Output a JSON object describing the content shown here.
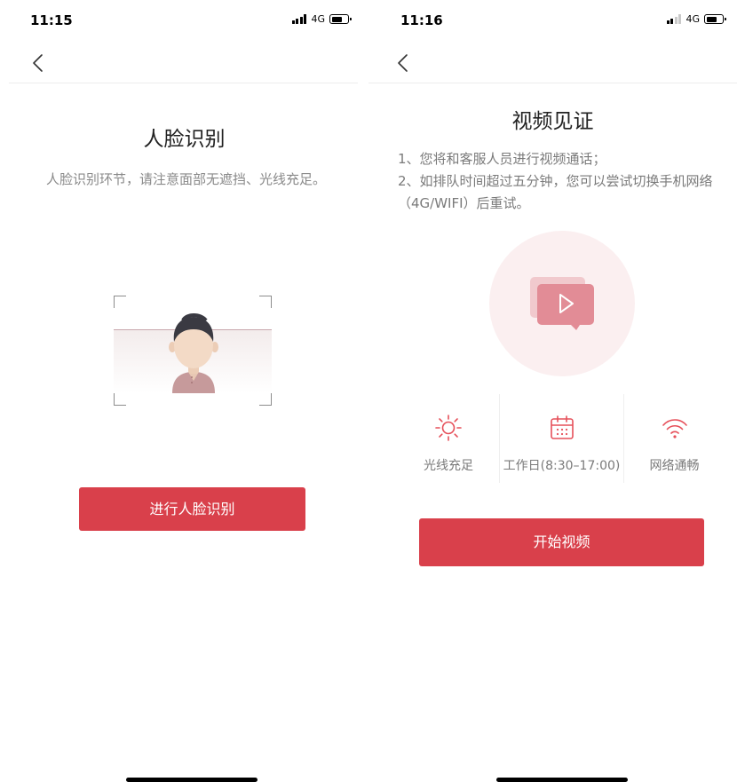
{
  "face_screen": {
    "status_bar": {
      "time": "11:15",
      "network": "4G"
    },
    "title": "人脸识别",
    "description": "人脸识别环节，请注意面部无遮挡、光线充足。",
    "button_label": "进行人脸识别"
  },
  "video_screen": {
    "status_bar": {
      "time": "11:16",
      "network": "4G"
    },
    "title": "视频见证",
    "instructions": [
      "1、您将和客服人员进行视频通话；",
      "2、如排队时间超过五分钟，您可以尝试切换手机网络（4G/WIFI）后重试。"
    ],
    "features": [
      {
        "icon": "sun-icon",
        "label": "光线充足"
      },
      {
        "icon": "calendar-icon",
        "label": "工作日(8:30–17:00)"
      },
      {
        "icon": "wifi-icon",
        "label": "网络通畅"
      }
    ],
    "button_label": "开始视频"
  },
  "colors": {
    "primary": "#d9404b",
    "icon_accent": "#e6505a",
    "video_circle": "#fbeff0",
    "muted_text": "#8a8a8a"
  }
}
